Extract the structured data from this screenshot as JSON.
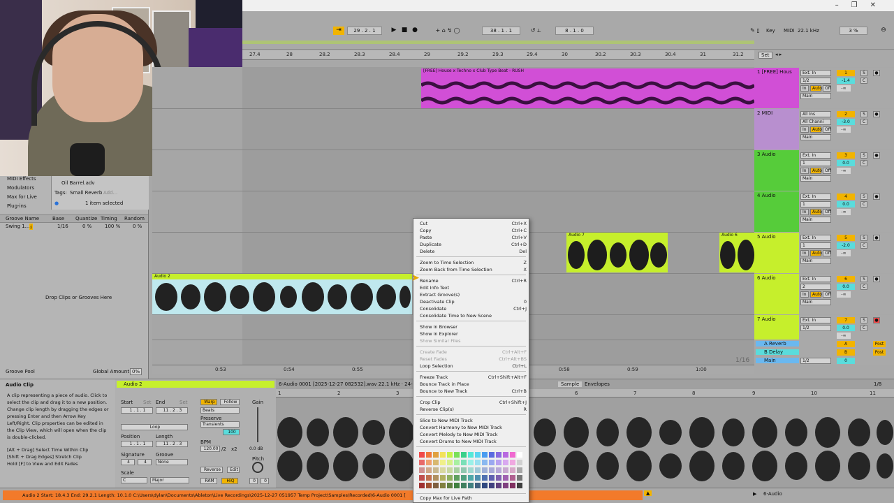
{
  "transport": {
    "position": "29 . 2 . 1",
    "loop_start": "38 . 1 . 1",
    "loop_length": "8 . 1 . 0",
    "key_label": "Key",
    "midi_label": "MIDI",
    "sample_rate": "22.1 kHz",
    "cpu": "3 %"
  },
  "ruler": {
    "ticks": [
      "27.4",
      "28",
      "28.2",
      "28.3",
      "28.4",
      "29",
      "29.2",
      "29.3",
      "29.4",
      "30",
      "30.2",
      "30.3",
      "30.4",
      "31",
      "31.2"
    ],
    "set_label": "Set"
  },
  "browser": {
    "categories": [
      "MIDI Effects",
      "Modulators",
      "Max for Live",
      "Plug-ins"
    ],
    "file": "Oil Barrel.adv",
    "tags_label": "Tags:",
    "tag": "Small Reverb",
    "tag_add": "Add...",
    "selection": "1 item selected",
    "groove_headers": [
      "Groove Name",
      "Base",
      "Quantize",
      "Timing",
      "Random"
    ],
    "groove_row": [
      "Swing 1...",
      "1/16",
      "0 %",
      "100 %",
      "0 %"
    ],
    "drop_text": "Drop Clips or Grooves Here",
    "groove_pool": "Groove Pool",
    "global_amount_label": "Global Amount:",
    "global_amount": "0%"
  },
  "tracks": [
    {
      "name": "1 [FREE] Hous",
      "input": "Ext. In",
      "channel": "1/2",
      "monitor": "Main",
      "number": "1",
      "vol": "-1.4",
      "pan": "C",
      "color": "#d14fd6"
    },
    {
      "name": "2 MIDI",
      "input": "All Ins",
      "channel": "All Channi",
      "monitor": "Main",
      "number": "2",
      "vol": "-3.0",
      "pan": "C",
      "color": "#b88fcf"
    },
    {
      "name": "3 Audio",
      "input": "Ext. In",
      "channel": "1",
      "monitor": "Main",
      "number": "3",
      "vol": "0.0",
      "pan": "C",
      "color": "#56cc3a"
    },
    {
      "name": "4 Audio",
      "input": "Ext. In",
      "channel": "1",
      "monitor": "Main",
      "number": "4",
      "vol": "0.0",
      "pan": "C",
      "color": "#56cc3a"
    },
    {
      "name": "5 Audio",
      "input": "Ext. In",
      "channel": "1",
      "monitor": "Main",
      "number": "5",
      "vol": "-2.0",
      "pan": "C",
      "color": "#c6ef2c"
    },
    {
      "name": "6 Audio",
      "input": "Ext. In",
      "channel": "2",
      "monitor": "Main",
      "number": "6",
      "vol": "0.0",
      "pan": "C",
      "color": "#c6ef2c"
    },
    {
      "name": "7 Audio",
      "input": "Ext. In",
      "channel": "1/2",
      "monitor": "Main",
      "number": "7",
      "vol": "0.0",
      "pan": "C",
      "color": "#c6ef2c"
    }
  ],
  "returns": [
    {
      "name": "A Reverb",
      "letter": "A",
      "post": "Post"
    },
    {
      "name": "B Delay",
      "letter": "B",
      "post": "Post"
    },
    {
      "name": "Main",
      "letter": "0",
      "channel": "1/2"
    }
  ],
  "common_labels": {
    "in": "In",
    "auto": "Auto",
    "off": "Off",
    "s": "S",
    "neg_inf": "-∞"
  },
  "clips": {
    "beat_title": "[FREE] House x Techno x Club Type Beat - RUSH",
    "audio2": "Audio 2",
    "audio7": "Audio 7",
    "audio6": "Audio 6"
  },
  "time_ruler": [
    "0:53",
    "0:54",
    "0:55",
    "0:58",
    "0:59",
    "1:00"
  ],
  "zoom_label": "1/16",
  "info": {
    "title": "Audio Clip",
    "body": "A clip representing a piece of audio. Click to select the clip and drag it to a new position. Change clip length by dragging the edges or pressing Enter and then Arrow Key Left/Right. Clip properties can be edited in the Clip View, which will open when the clip is double-clicked.",
    "hint1": "[Alt + Drag] Select Time Within Clip",
    "hint2": "[Shift + Drag Edges] Stretch Clip",
    "hint3": "Hold [F] to View and Edit Fades"
  },
  "clipview": {
    "clip_name": "Audio 2",
    "file_info": "6-Audio 0001 [2025-12-27 082532].wav  22.1 kHz · 24-Bit",
    "start_label": "Start",
    "end_label": "End",
    "set": "Set",
    "start": "1 . 1 . 1",
    "end": "11 . 2 . 3",
    "loop": "Loop",
    "position_label": "Position",
    "length_label": "Length",
    "position": "1 . 1 . 1",
    "length": "11 . 2 . 3",
    "signature_label": "Signature",
    "groove_label": "Groove",
    "sig_num": "4",
    "sig_den": "4",
    "groove": "None",
    "scale_label": "Scale",
    "scale_root": "C",
    "scale_mode": "Major",
    "warp": "Warp",
    "follow": "Follow",
    "beats": "Beats",
    "preserve_label": "Preserve",
    "preserve": "Transients",
    "bpm_label": "BPM",
    "bpm": "120.00",
    "half": "/2",
    "double": "x2",
    "reverse": "Reverse",
    "edit": "Edit",
    "ram": "RAM",
    "hiq": "HiQ",
    "gain_label": "Gain",
    "gain": "0.0 dB",
    "pitch_label": "Pitch",
    "pitch_a": "0",
    "pitch_b": "0",
    "warp_count": "100"
  },
  "sampleview": {
    "tabs": [
      "Sample",
      "Envelopes"
    ],
    "page": "1/8",
    "ticks": [
      "1",
      "2",
      "3",
      "6",
      "7",
      "8",
      "9",
      "10",
      "11"
    ]
  },
  "status": {
    "text": "Audio 2  Start: 18.4.3  End: 29.2.1  Length: 10.1.0  C:\\Users\\dylan\\Documents\\Ableton\\Live Recordings\\2025-12-27 051957 Temp Project\\Samples\\Recorded\\6-Audio 0001 [",
    "track": "6-Audio"
  },
  "context_menu": {
    "groups": [
      [
        {
          "label": "Cut",
          "shortcut": "Ctrl+X"
        },
        {
          "label": "Copy",
          "shortcut": "Ctrl+C"
        },
        {
          "label": "Paste",
          "shortcut": "Ctrl+V"
        },
        {
          "label": "Duplicate",
          "shortcut": "Ctrl+D"
        },
        {
          "label": "Delete",
          "shortcut": "Del"
        }
      ],
      [
        {
          "label": "Zoom to Time Selection",
          "shortcut": "Z"
        },
        {
          "label": "Zoom Back from Time Selection",
          "shortcut": "X"
        }
      ],
      [
        {
          "label": "Rename",
          "shortcut": "Ctrl+R"
        },
        {
          "label": "Edit Info Text",
          "shortcut": ""
        },
        {
          "label": "Extract Groove(s)",
          "shortcut": ""
        },
        {
          "label": "Deactivate Clip",
          "shortcut": "0"
        },
        {
          "label": "Consolidate",
          "shortcut": "Ctrl+J"
        },
        {
          "label": "Consolidate Time to New Scene",
          "shortcut": ""
        }
      ],
      [
        {
          "label": "Show in Browser",
          "shortcut": ""
        },
        {
          "label": "Show in Explorer",
          "shortcut": ""
        },
        {
          "label": "Show Similar Files",
          "shortcut": "",
          "disabled": true
        }
      ],
      [
        {
          "label": "Create Fade",
          "shortcut": "Ctrl+Alt+F",
          "disabled": true
        },
        {
          "label": "Reset Fades",
          "shortcut": "Ctrl+Alt+BS",
          "disabled": true
        },
        {
          "label": "Loop Selection",
          "shortcut": "Ctrl+L"
        }
      ],
      [
        {
          "label": "Freeze Track",
          "shortcut": "Ctrl+Shift+Alt+F"
        },
        {
          "label": "Bounce Track in Place",
          "shortcut": ""
        },
        {
          "label": "Bounce to New Track",
          "shortcut": "Ctrl+B"
        }
      ],
      [
        {
          "label": "Crop Clip",
          "shortcut": "Ctrl+Shift+J"
        },
        {
          "label": "Reverse Clip(s)",
          "shortcut": "R"
        }
      ],
      [
        {
          "label": "Slice to New MIDI Track",
          "shortcut": ""
        },
        {
          "label": "Convert Harmony to New MIDI Track",
          "shortcut": ""
        },
        {
          "label": "Convert Melody to New MIDI Track",
          "shortcut": ""
        },
        {
          "label": "Convert Drums to New MIDI Track",
          "shortcut": ""
        }
      ]
    ],
    "footer": "Copy Max for Live Path",
    "palette": [
      "#f04a4a",
      "#f0783c",
      "#e0a040",
      "#f3e25a",
      "#c8f04a",
      "#7ae05a",
      "#3ad08a",
      "#55e8d8",
      "#5ad4f0",
      "#4a9cf0",
      "#5a6ae0",
      "#8a6ae0",
      "#b86ae0",
      "#f06ad0",
      "#ffffff",
      "#e86a6a",
      "#f0a070",
      "#d8b870",
      "#f0f08a",
      "#d8f08a",
      "#a8f0a0",
      "#7ae0b8",
      "#9af0e8",
      "#9ae0f0",
      "#8ab8f0",
      "#9aa8f0",
      "#b8a0f0",
      "#d8a8f0",
      "#f0a8e0",
      "#d0d0d0",
      "#d09090",
      "#d0a888",
      "#c8b890",
      "#d8d8a0",
      "#c8d8a0",
      "#a8d0a0",
      "#90c8b0",
      "#a0d8d0",
      "#a0c8d8",
      "#a0b0d8",
      "#a8a8d8",
      "#b8a8d8",
      "#c8a8d0",
      "#d8a8c8",
      "#a8a8a8",
      "#c05050",
      "#c07050",
      "#b09060",
      "#b0b060",
      "#90b060",
      "#60a060",
      "#50a080",
      "#50a8a8",
      "#5090b0",
      "#5070b0",
      "#6060b0",
      "#8060b0",
      "#a060b0",
      "#b06090",
      "#787878",
      "#a03030",
      "#a05030",
      "#806040",
      "#808040",
      "#608040",
      "#408040",
      "#408060",
      "#408080",
      "#406080",
      "#304880",
      "#404080",
      "#604080",
      "#804080",
      "#803060",
      "#404040"
    ]
  }
}
